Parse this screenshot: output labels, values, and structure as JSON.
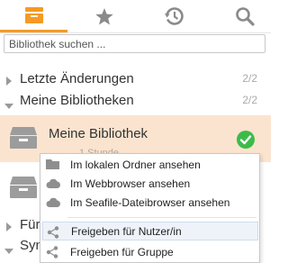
{
  "tabs": [
    {
      "name": "libraries",
      "icon": "archive-box-icon",
      "active": true
    },
    {
      "name": "starred",
      "icon": "star-icon",
      "active": false
    },
    {
      "name": "activities",
      "icon": "history-icon",
      "active": false
    },
    {
      "name": "search",
      "icon": "search-icon",
      "active": false
    }
  ],
  "search": {
    "placeholder": "Bibliothek suchen ..."
  },
  "groups": [
    {
      "label": "Letzte Änderungen",
      "count": "2/2",
      "expanded": false
    },
    {
      "label": "Meine Bibliotheken",
      "count": "2/2",
      "expanded": true
    }
  ],
  "library": {
    "name": "Meine Bibliothek",
    "sub": "1 Stunde"
  },
  "lower_groups": [
    {
      "label": "Für"
    },
    {
      "label": "Syn"
    }
  ],
  "menu": {
    "items": [
      {
        "label": "Im lokalen Ordner ansehen",
        "icon": "folder-icon"
      },
      {
        "label": "Im Webbrowser ansehen",
        "icon": "cloud-icon"
      },
      {
        "label": "Im Seafile-Dateibrowser ansehen",
        "icon": "cloud-icon"
      },
      {
        "label": "Freigeben für Nutzer/in",
        "icon": "share-icon"
      },
      {
        "label": "Freigeben für Gruppe",
        "icon": "share-icon"
      }
    ]
  },
  "colors": {
    "accent": "#f59a23",
    "selected_bg": "#fbe4cf",
    "sync_ok": "#3dbb4a"
  }
}
